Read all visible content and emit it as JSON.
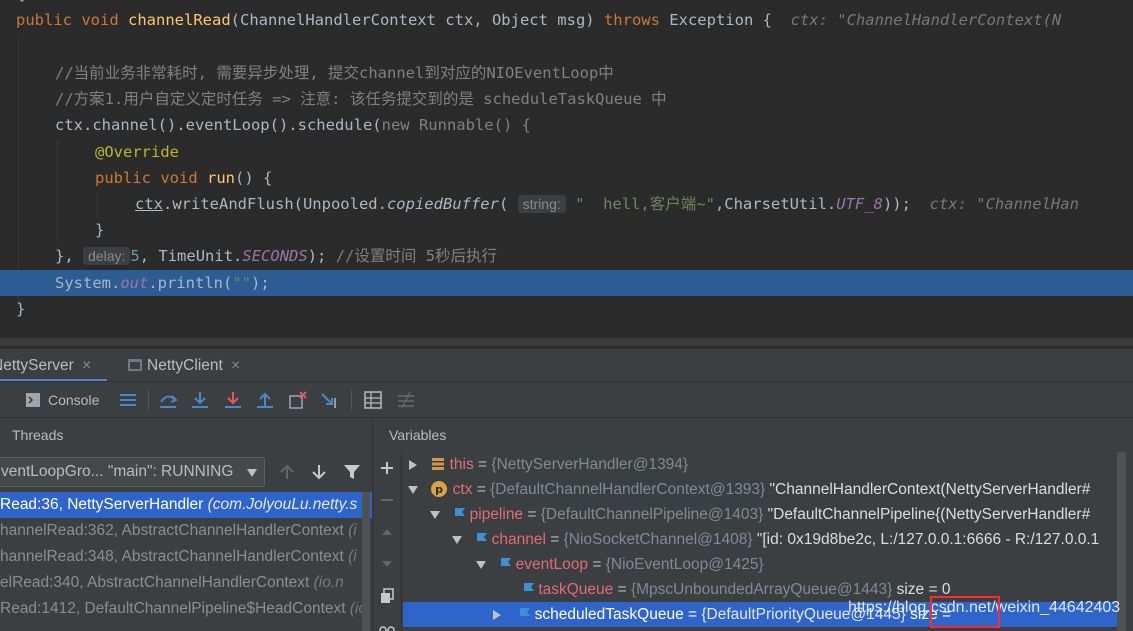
{
  "editor": {
    "lines": {
      "sig_public": "public",
      "sig_void": "void",
      "sig_method": "channelRead",
      "sig_params": "(ChannelHandlerContext ctx, Object msg) ",
      "sig_throws": "throws",
      "sig_exception": " Exception {",
      "sig_hint": "ctx: \"ChannelHandlerContext(N",
      "comment1": "//当前业务非常耗时, 需要异步处理, 提交channel到对应的NIOEventLoop中",
      "comment2": "//方案1.用户自定义定时任务 => 注意: 该任务提交到的是 scheduleTaskQueue 中",
      "schedule_a": "ctx.channel().eventLoop().schedule(",
      "schedule_new": "new",
      "schedule_b": " Runnable() {",
      "override": "@Override",
      "run_public": "public",
      "run_void": "void",
      "run_name": "run",
      "run_rest": "() {",
      "write_ctx": "ctx",
      "write_a": ".writeAndFlush(Unpooled.",
      "write_copied": "copiedBuffer",
      "write_paren": "(",
      "write_pill": "string:",
      "write_str": "\"  hell,客户端~\"",
      "write_b": ",CharsetUtil.",
      "write_utf": "UTF_8",
      "write_c": "));",
      "write_hint": "ctx: \"ChannelHan",
      "close_inner": "}",
      "sched_end_a": "},",
      "sched_pill": "delay:",
      "sched_num": "5",
      "sched_end_b": ", TimeUnit.",
      "sched_seconds": "SECONDS",
      "sched_end_c": ");",
      "sched_comment": "//设置时间 5秒后执行",
      "println_a": "System.",
      "println_out": "out",
      "println_b": ".println(",
      "println_str": "\"\"",
      "println_c": ");",
      "close_method": "}"
    }
  },
  "tabs": {
    "tab1": "NettyServer",
    "tab2": "NettyClient",
    "close": "×"
  },
  "toolbar": {
    "console": "Console"
  },
  "threads": {
    "header": "Threads",
    "thread_select": "ventLoopGro... \"main\": RUNNING",
    "frames": [
      {
        "method": "Read:36, NettyServerHandler ",
        "cls": "(com.JolyouLu.netty.s"
      },
      {
        "method": "hannelRead:362, AbstractChannelHandlerContext ",
        "cls": "(i"
      },
      {
        "method": "hannelRead:348, AbstractChannelHandlerContext ",
        "cls": "(i"
      },
      {
        "method": "elRead:340, AbstractChannelHandlerContext ",
        "cls": "(io.n"
      },
      {
        "method": "Read:1412, DefaultChannelPipeline$HeadContext ",
        "cls": "(io"
      }
    ]
  },
  "variables": {
    "header": "Variables",
    "rows": [
      {
        "name": "this",
        "eq": " = ",
        "val": "{NettyServerHandler@1394}",
        "extra": ""
      },
      {
        "name": "ctx",
        "eq": " = ",
        "val": "{DefaultChannelHandlerContext@1393}",
        "extra": " \"ChannelHandlerContext(NettyServerHandler#"
      },
      {
        "name": "pipeline",
        "eq": " = ",
        "val": "{DefaultChannelPipeline@1403}",
        "extra": " \"DefaultChannelPipeline{(NettyServerHandler#"
      },
      {
        "name": "channel",
        "eq": " = ",
        "val": "{NioSocketChannel@1408}",
        "extra": " \"[id: 0x19d8be2c, L:/127.0.0.1:6666 - R:/127.0.0.1"
      },
      {
        "name": "eventLoop",
        "eq": " = ",
        "val": "{NioEventLoop@1425}",
        "extra": ""
      },
      {
        "name": "taskQueue",
        "eq": " = ",
        "val": "{MpscUnboundedArrayQueue@1443}",
        "extra": "  size = 0"
      },
      {
        "name": "scheduledTaskQueue",
        "eq": " = ",
        "val": "{DefaultPriorityQueue@1445}",
        "extra": "  size = "
      }
    ]
  },
  "watermark": "https://blog.csdn.net/weixin_44642403",
  "colors": {
    "highlight": "#2d5c93",
    "selection": "#2f65ca",
    "red_box": "#ff2a2a"
  }
}
